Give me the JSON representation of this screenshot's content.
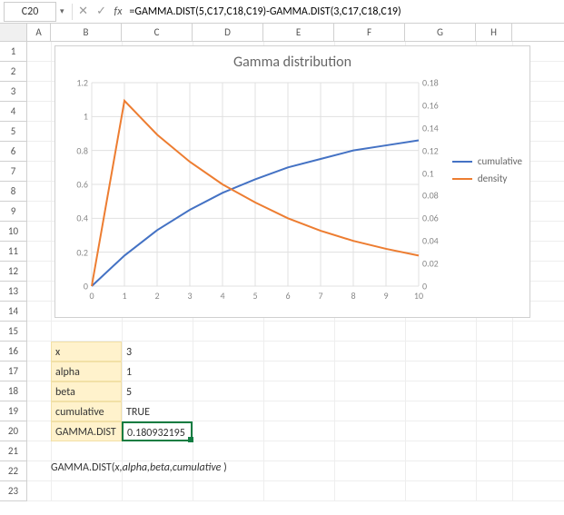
{
  "formula_bar": {
    "name_box": "C20",
    "formula": "=GAMMA.DIST(5,C17,C18,C19)-GAMMA.DIST(3,C17,C18,C19)"
  },
  "columns": [
    "A",
    "B",
    "C",
    "D",
    "E",
    "F",
    "G",
    "H"
  ],
  "rows": [
    "1",
    "2",
    "3",
    "4",
    "5",
    "6",
    "7",
    "8",
    "9",
    "10",
    "11",
    "12",
    "13",
    "14",
    "15",
    "16",
    "17",
    "18",
    "19",
    "20",
    "21",
    "22",
    "23"
  ],
  "chart_data": {
    "type": "line",
    "title": "Gamma distribution",
    "xlabel": "",
    "ylabel_left": "",
    "ylabel_right": "",
    "x": [
      0,
      1,
      2,
      3,
      4,
      5,
      6,
      7,
      8,
      9,
      10
    ],
    "series": [
      {
        "name": "cumulative",
        "axis": "left",
        "color": "#4472c4",
        "values": [
          0,
          0.18,
          0.33,
          0.45,
          0.55,
          0.63,
          0.7,
          0.75,
          0.8,
          0.83,
          0.86
        ]
      },
      {
        "name": "density",
        "axis": "right",
        "color": "#ed7d31",
        "values": [
          0,
          0.164,
          0.134,
          0.11,
          0.09,
          0.074,
          0.06,
          0.049,
          0.04,
          0.033,
          0.027
        ]
      }
    ],
    "y_left": {
      "min": 0,
      "max": 1.2,
      "step": 0.2,
      "ticks": [
        "0",
        "0.2",
        "0.4",
        "0.6",
        "0.8",
        "1",
        "1.2"
      ]
    },
    "y_right": {
      "min": 0,
      "max": 0.18,
      "step": 0.02,
      "ticks": [
        "0",
        "0.02",
        "0.04",
        "0.06",
        "0.08",
        "0.1",
        "0.12",
        "0.14",
        "0.16",
        "0.18"
      ]
    },
    "x_ticks": [
      "0",
      "1",
      "2",
      "3",
      "4",
      "5",
      "6",
      "7",
      "8",
      "9",
      "10"
    ],
    "legend": [
      "cumulative",
      "density"
    ]
  },
  "table": {
    "rows": [
      {
        "label": "x",
        "value": "3"
      },
      {
        "label": "alpha",
        "value": "1"
      },
      {
        "label": "beta",
        "value": "5"
      },
      {
        "label": "cumulative",
        "value": "TRUE"
      },
      {
        "label": "GAMMA.DIST",
        "value": "0.180932195"
      }
    ]
  },
  "syntax": {
    "fn": "GAMMA.DIST(",
    "args": "x,alpha,beta,cumulative",
    "close": " )"
  },
  "colors": {
    "series1": "#4472c4",
    "series2": "#ed7d31",
    "selection": "#107c41",
    "label_bg": "#fff2cc"
  }
}
